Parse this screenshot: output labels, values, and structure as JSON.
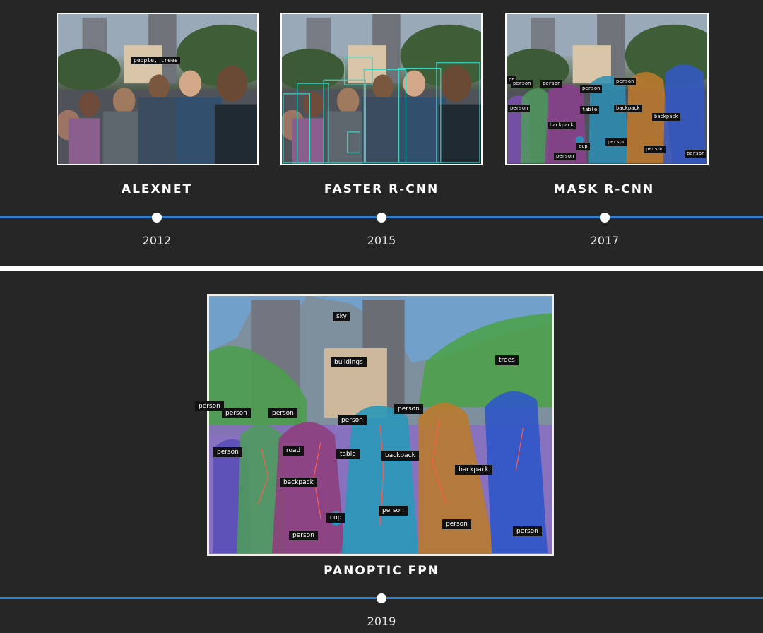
{
  "milestones": [
    {
      "method": "ALEXNET",
      "year": "2012",
      "caption": "people, trees"
    },
    {
      "method": "FASTER R-CNN",
      "year": "2015"
    },
    {
      "method": "MASK R-CNN",
      "year": "2017",
      "labels": [
        "on",
        "person",
        "person",
        "person",
        "person",
        "person",
        "table",
        "backpack",
        "backpack",
        "backpack",
        "cup",
        "person",
        "person",
        "person",
        "person"
      ]
    },
    {
      "method": "PANOPTIC FPN",
      "year": "2019",
      "labels": [
        "sky",
        "buildings",
        "trees",
        "person",
        "person",
        "person",
        "person",
        "person",
        "road",
        "table",
        "backpack",
        "backpack",
        "backpack",
        "cup",
        "person",
        "person",
        "person",
        "person",
        "person"
      ]
    }
  ],
  "colors": {
    "background": "#262626",
    "timeline": "#2f7fd1",
    "divider": "#ffffff",
    "dot": "#ffffff"
  }
}
